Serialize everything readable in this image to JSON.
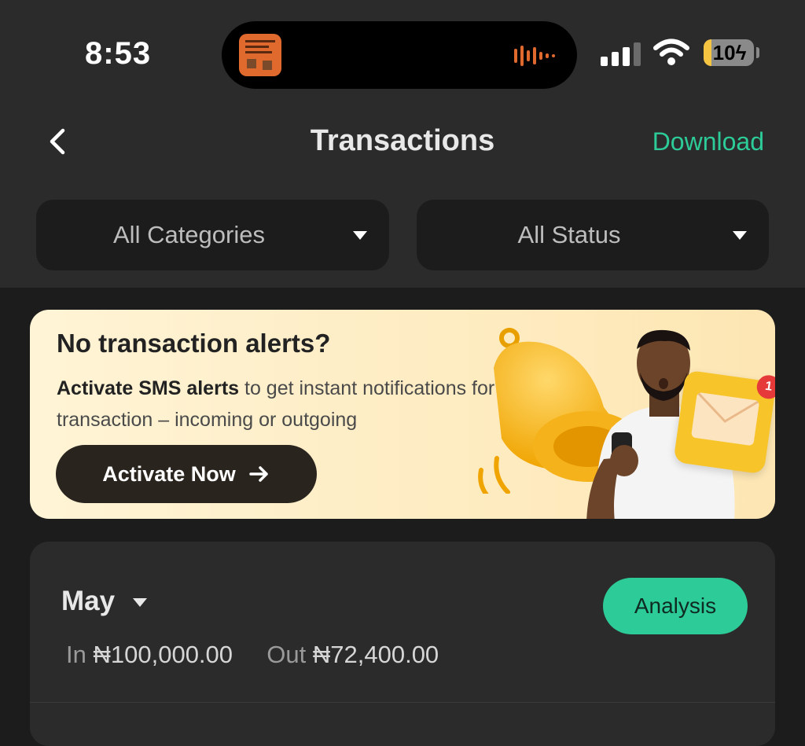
{
  "status_bar": {
    "time": "8:53",
    "battery": "10"
  },
  "nav": {
    "title": "Transactions",
    "download_label": "Download"
  },
  "filters": {
    "category": "All Categories",
    "status": "All Status"
  },
  "banner": {
    "title": "No transaction alerts?",
    "text_bold": "Activate SMS alerts",
    "text_rest": " to get instant notifications for every transaction – incoming or outgoing",
    "button_label": "Activate Now",
    "badge_count": "1"
  },
  "summary": {
    "month": "May",
    "analysis_label": "Analysis",
    "in_label": "In",
    "in_amount": "₦100,000.00",
    "out_label": "Out",
    "out_amount": "₦72,400.00"
  },
  "colors": {
    "accent": "#2ccb97",
    "background": "#1c1c1c",
    "panel": "#2b2b2b",
    "banner": "#fde6b3"
  }
}
